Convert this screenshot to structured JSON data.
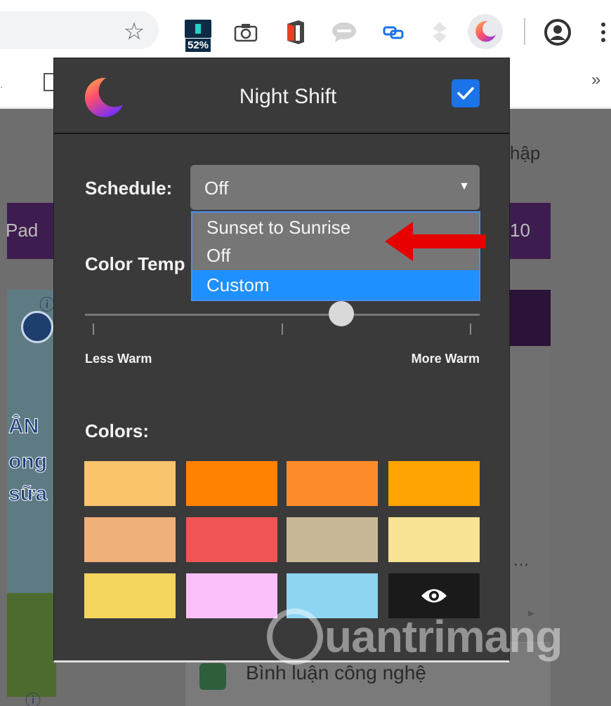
{
  "toolbar": {
    "battery_badge": "52%",
    "icons": [
      "star-icon",
      "battery-extension-icon",
      "camera-icon",
      "office-icon",
      "chat-icon",
      "link-icon",
      "puzzle-icon",
      "night-shift-icon",
      "account-icon",
      "menu-icon"
    ]
  },
  "bookmarks": {
    "more": "»"
  },
  "webpage": {
    "pad_text": "Pad",
    "nhap_text": "hập",
    "ten_text": "10",
    "ad_words": [
      "ÂN",
      "ong",
      "sữa"
    ],
    "ellipsis": "…",
    "bottom_text": "Bình luận công nghệ"
  },
  "popup": {
    "title": "Night Shift",
    "enabled": true,
    "schedule_label": "Schedule:",
    "schedule_value": "Off",
    "schedule_options": [
      "Sunset to Sunrise",
      "Off",
      "Custom"
    ],
    "highlighted_option": "Custom",
    "color_temp_label": "Color Temperature:",
    "color_temp_visible": "Color Temp",
    "color_temp_value_fraction": 0.65,
    "less_warm_label": "Less Warm",
    "more_warm_label": "More Warm",
    "colors_label": "Colors:",
    "swatches": [
      "#f9c46b",
      "#ff8200",
      "#ff8c2b",
      "#ffa400",
      "#efb07a",
      "#f25555",
      "#c9b898",
      "#f9e394",
      "#f4d55d",
      "#fbbff9",
      "#8dd5f1",
      "#1a1a1a"
    ],
    "eye_swatch_icon": "eye-icon"
  },
  "colors": {
    "popup_bg": "#3a3a3a",
    "accent": "#1e90ff",
    "arrow": "#e60000"
  },
  "watermark": {
    "text": "uantrimang"
  }
}
